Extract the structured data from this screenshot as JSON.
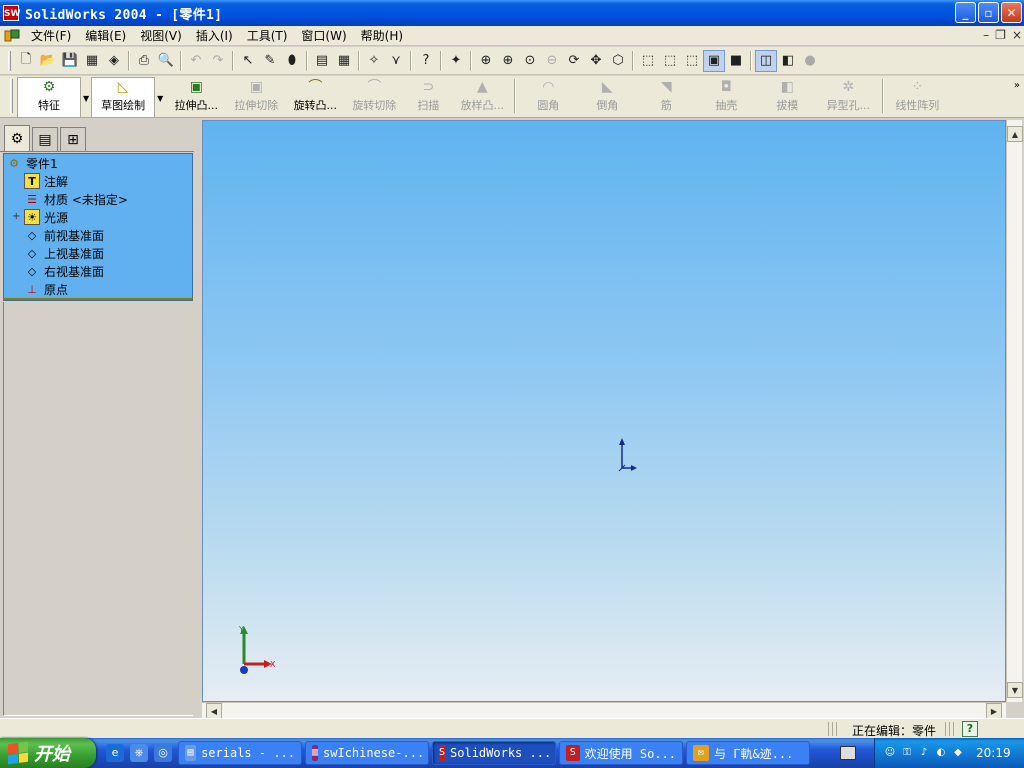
{
  "window": {
    "title": "SolidWorks 2004 - [零件1]",
    "app_icon_text": "SW",
    "min_label": "_",
    "max_label": "▫",
    "close_label": "✕"
  },
  "menu": {
    "items": [
      "文件(F)",
      "编辑(E)",
      "视图(V)",
      "插入(I)",
      "工具(T)",
      "窗口(W)",
      "帮助(H)"
    ],
    "mdi_min": "–",
    "mdi_restore": "❐",
    "mdi_close": "×"
  },
  "features_toolbar": {
    "tab_features": "特征",
    "tab_sketch": "草图绘制",
    "buttons": [
      "拉伸凸...",
      "拉伸切除",
      "旋转凸...",
      "旋转切除",
      "扫描",
      "放样凸...",
      "圆角",
      "倒角",
      "筋",
      "抽壳",
      "拔模",
      "异型孔...",
      "线性阵列"
    ]
  },
  "feature_tree": {
    "root": "零件1",
    "items": [
      "注解",
      "材质 <未指定>",
      "光源",
      "前视基准面",
      "上视基准面",
      "右视基准面",
      "原点"
    ],
    "expand_symbol": "+"
  },
  "triad": {
    "x_label": "X",
    "y_label": "Y"
  },
  "status": {
    "text": "正在编辑：零件",
    "help": "?"
  },
  "taskbar": {
    "start": "开始",
    "tasks": [
      "serials - ...",
      "swIchinese-...",
      "SolidWorks ...",
      "欢迎使用 So...",
      "与 Γ軌&迹..."
    ],
    "clock": "20:19"
  }
}
